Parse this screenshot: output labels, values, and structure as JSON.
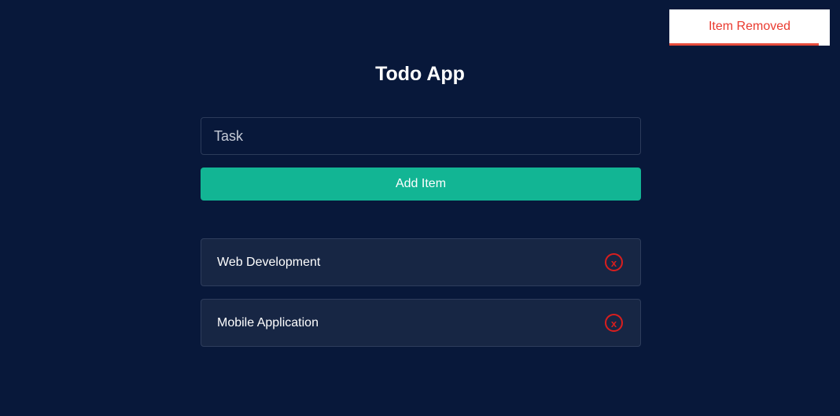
{
  "toast": {
    "message": "Item Removed",
    "progress": 0.93
  },
  "header": {
    "title": "Todo App"
  },
  "form": {
    "task_placeholder": "Task",
    "task_value": "",
    "add_label": "Add Item"
  },
  "todos": [
    {
      "label": "Web Development",
      "remove_icon": "close-circle-icon",
      "remove_glyph": "x"
    },
    {
      "label": "Mobile Application",
      "remove_icon": "close-circle-icon",
      "remove_glyph": "x"
    }
  ],
  "colors": {
    "background": "#08183a",
    "accent": "#12b594",
    "danger": "#d91e1e",
    "toast_text": "#ea3a2f",
    "card": "#172644"
  }
}
